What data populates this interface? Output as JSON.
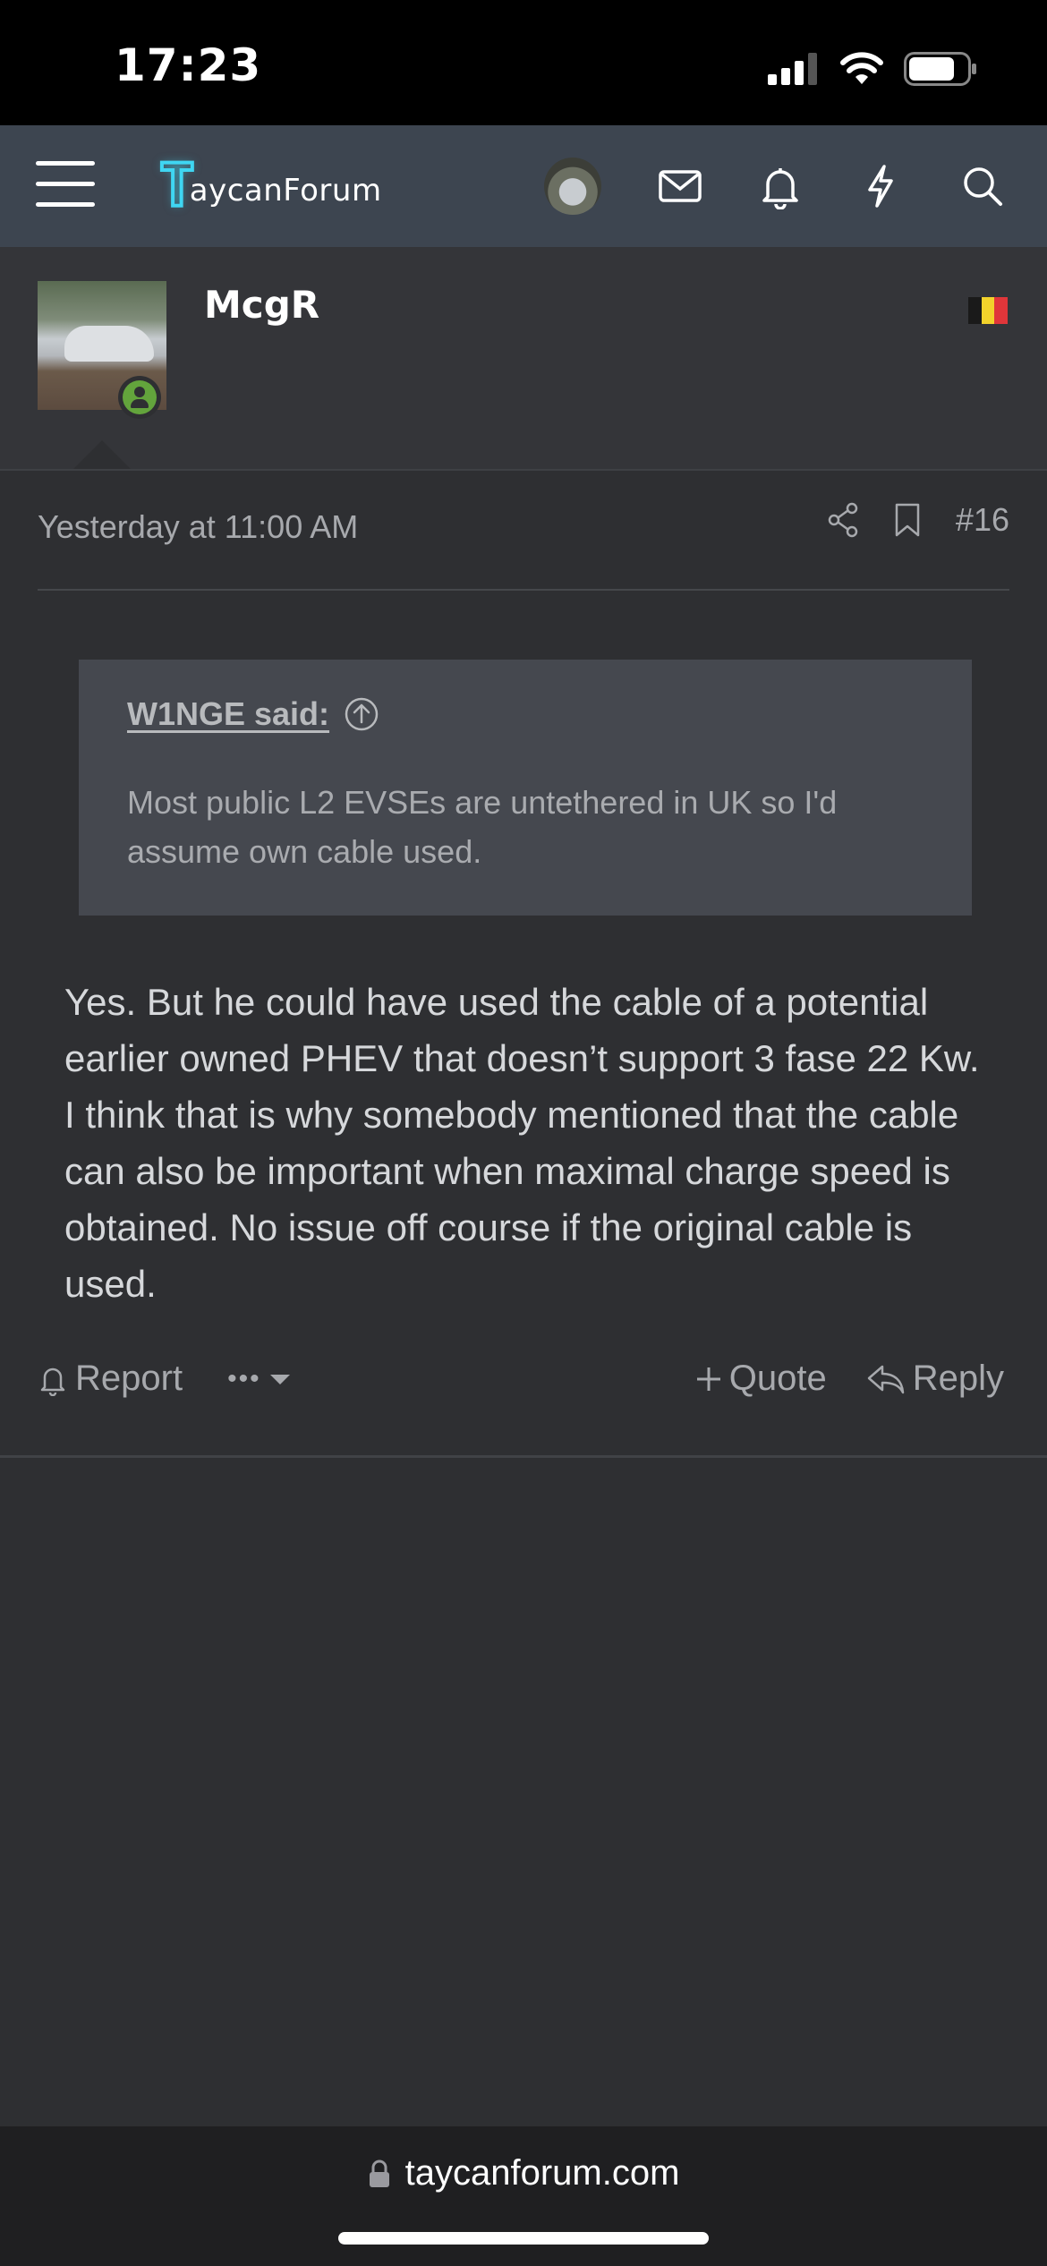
{
  "status_bar": {
    "time": "17:23"
  },
  "navbar": {
    "logo_mark": "T",
    "logo_text": "aycanForum",
    "icons": [
      "menu-icon",
      "account-avatar",
      "inbox-icon",
      "alerts-icon",
      "whats-new-icon",
      "search-icon"
    ]
  },
  "post": {
    "username": "McgR",
    "flag_country": "Belgium",
    "date": "Yesterday at 11:00 AM",
    "number": "#16",
    "quote": {
      "author": "W1NGE said:",
      "text": "Most public L2 EVSEs are untethered in UK so I'd assume own cable used."
    },
    "body": "Yes. But he could have used the cable of a potential earlier owned PHEV that doesn’t support 3 fase 22 Kw. I think that is why somebody mentioned that the cable can also be important when maximal charge speed is obtained. No issue off course if the original cable is used.",
    "actions": {
      "report": "Report",
      "more": "•••",
      "quote": "Quote",
      "reply": "Reply"
    }
  },
  "browser": {
    "url": "taycanforum.com"
  },
  "colors": {
    "accent_logo": "#3fd6f2",
    "online_green": "#63a43c",
    "navbar_bg": "#3d4550",
    "page_bg": "#2e2f32"
  }
}
